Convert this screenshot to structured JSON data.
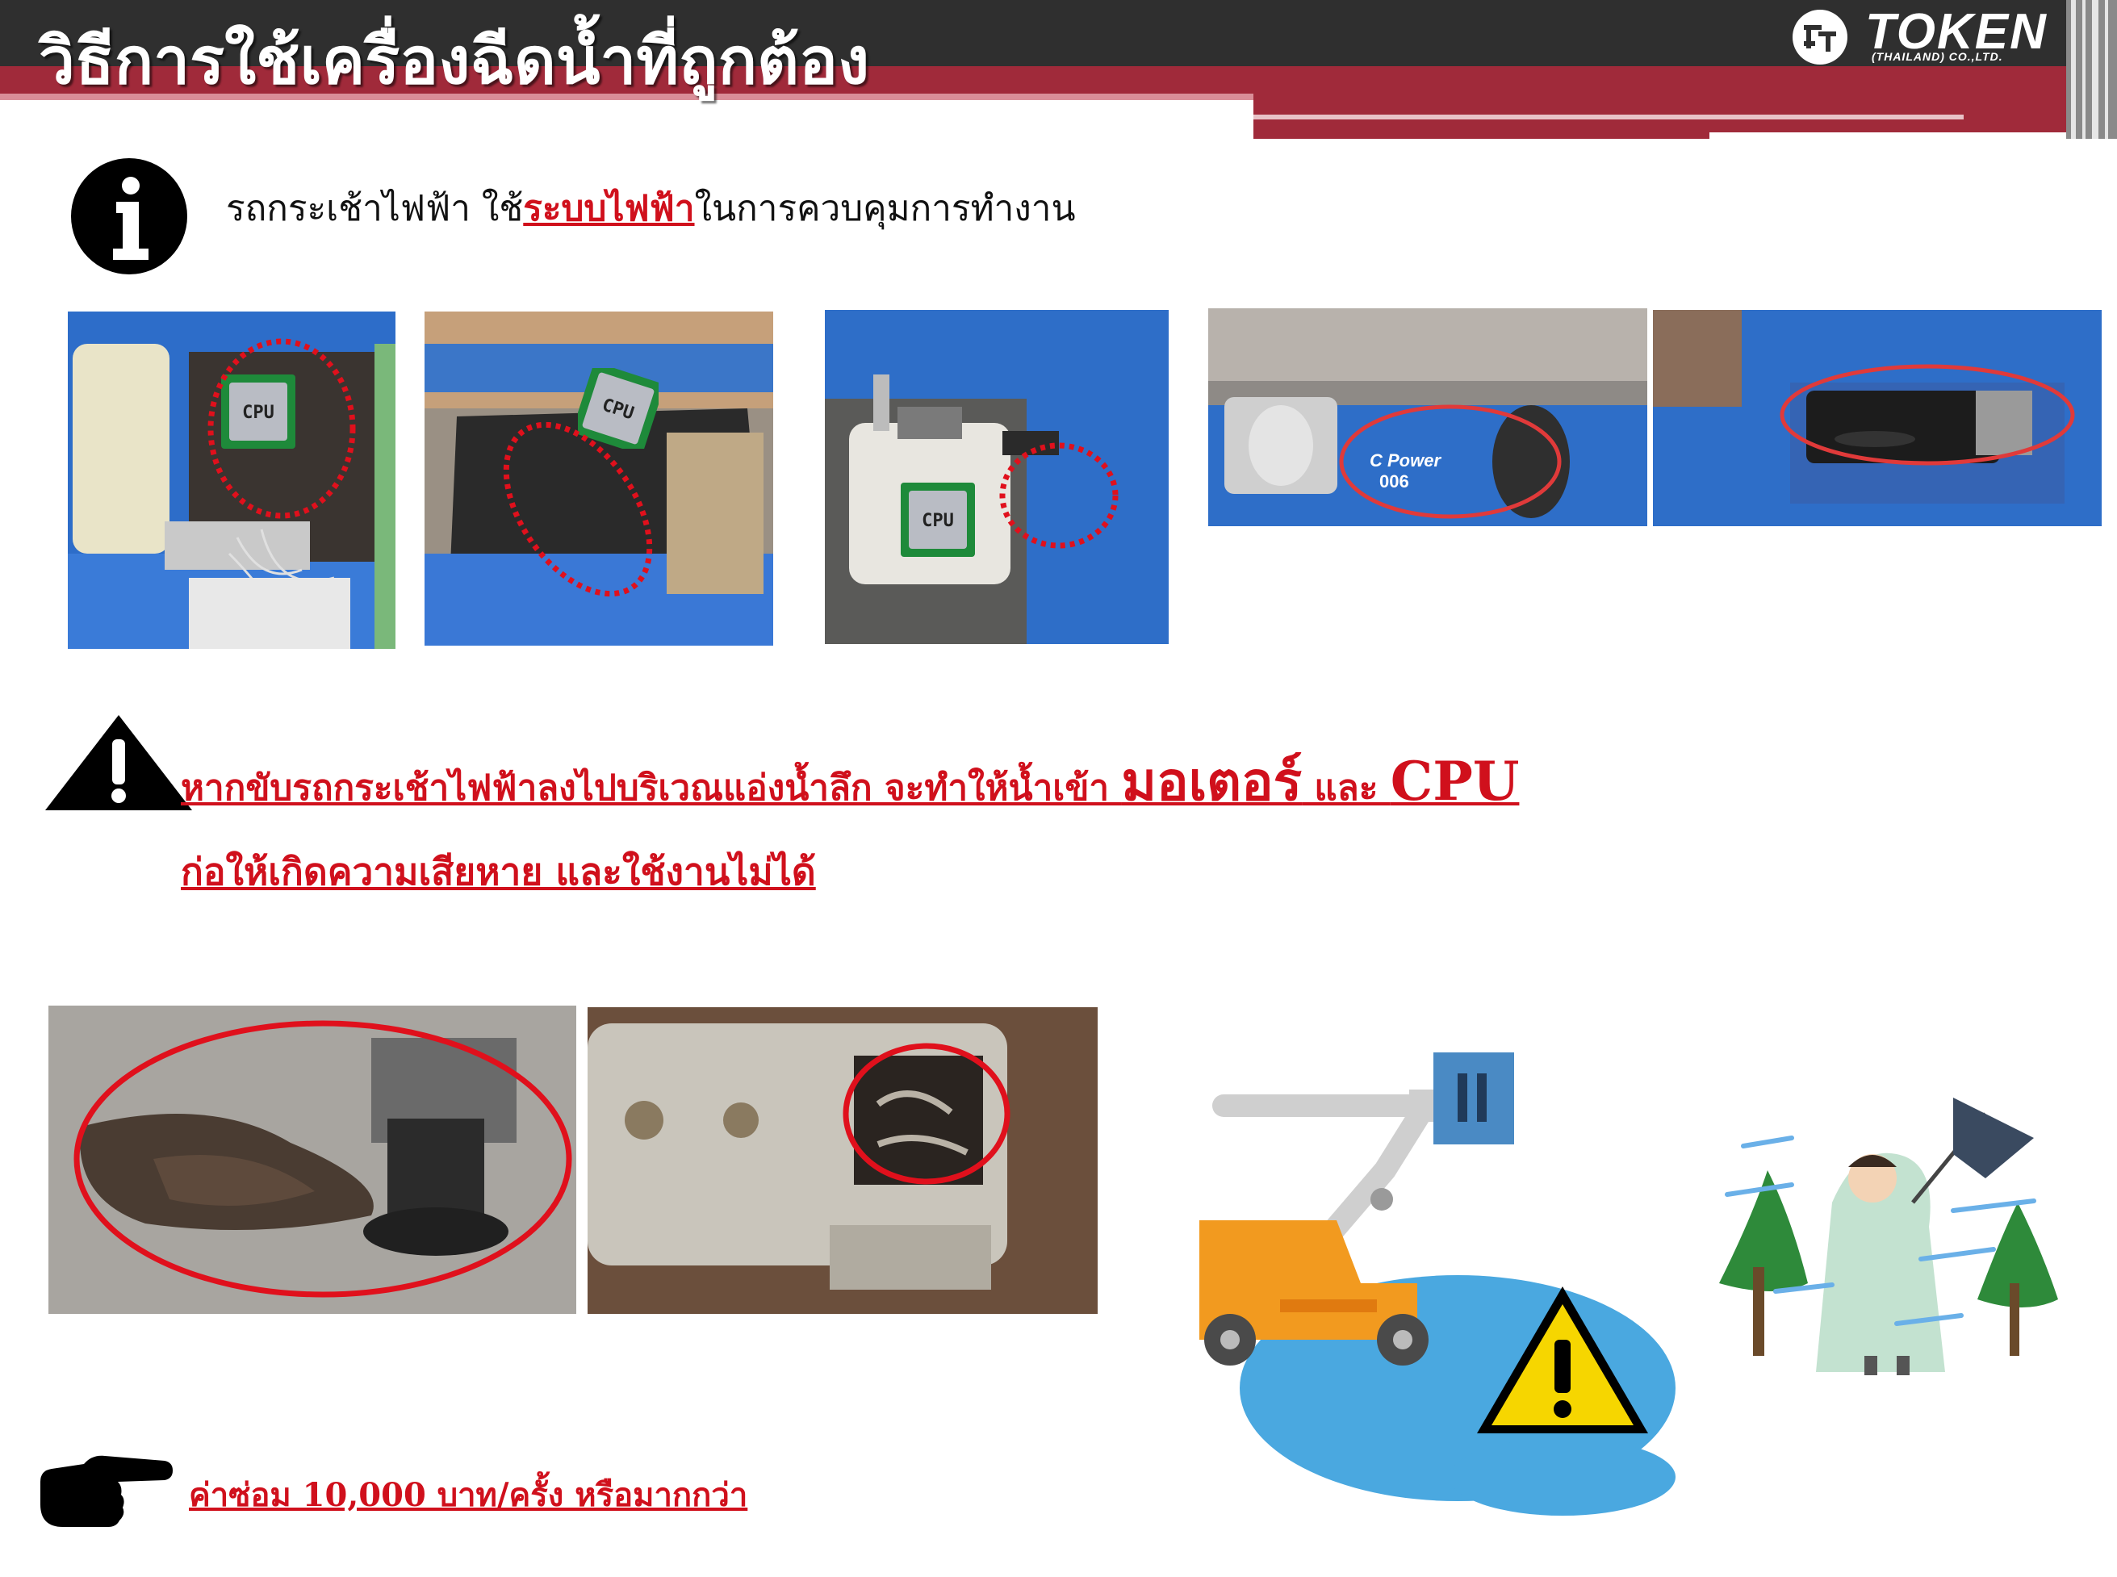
{
  "header": {
    "title": "วิธีการใช้เครื่องฉีดน้ำที่ถูกต้อง",
    "brand": {
      "name": "TOKEN",
      "subtitle": "(THAILAND) CO.,LTD."
    }
  },
  "info": {
    "icon": "info-icon",
    "text_before": "รถกระเช้าไฟฟ้า ใช้",
    "text_highlight": "ระบบไฟฟ้า",
    "text_after": "ในการควบคุมการทำงาน"
  },
  "photos": {
    "cpu_label": "CPU",
    "motor_text_1": "C Power",
    "motor_text_2": "006"
  },
  "warning": {
    "icon": "warning-triangle-icon",
    "line1_part1": "หากขับรถกระเช้าไฟฟ้าลงไปบริเวณแอ่งน้ำลึก จะทำให้น้ำเข้า ",
    "line1_motor": "มอเตอร์",
    "line1_and": " และ ",
    "line1_cpu": "CPU",
    "line2": "ก่อให้เกิดความเสียหาย และใช้งานไม่ได้"
  },
  "footer": {
    "icon": "pointing-hand-icon",
    "repair_cost": "ค่าซ่อม 10,000 บาท/ครั้ง หรือมากกว่า"
  },
  "colors": {
    "header_dark": "#2f2f2f",
    "header_red": "#a02a3a",
    "warning_red": "#d0101c",
    "machine_blue": "#2a6fd1"
  }
}
